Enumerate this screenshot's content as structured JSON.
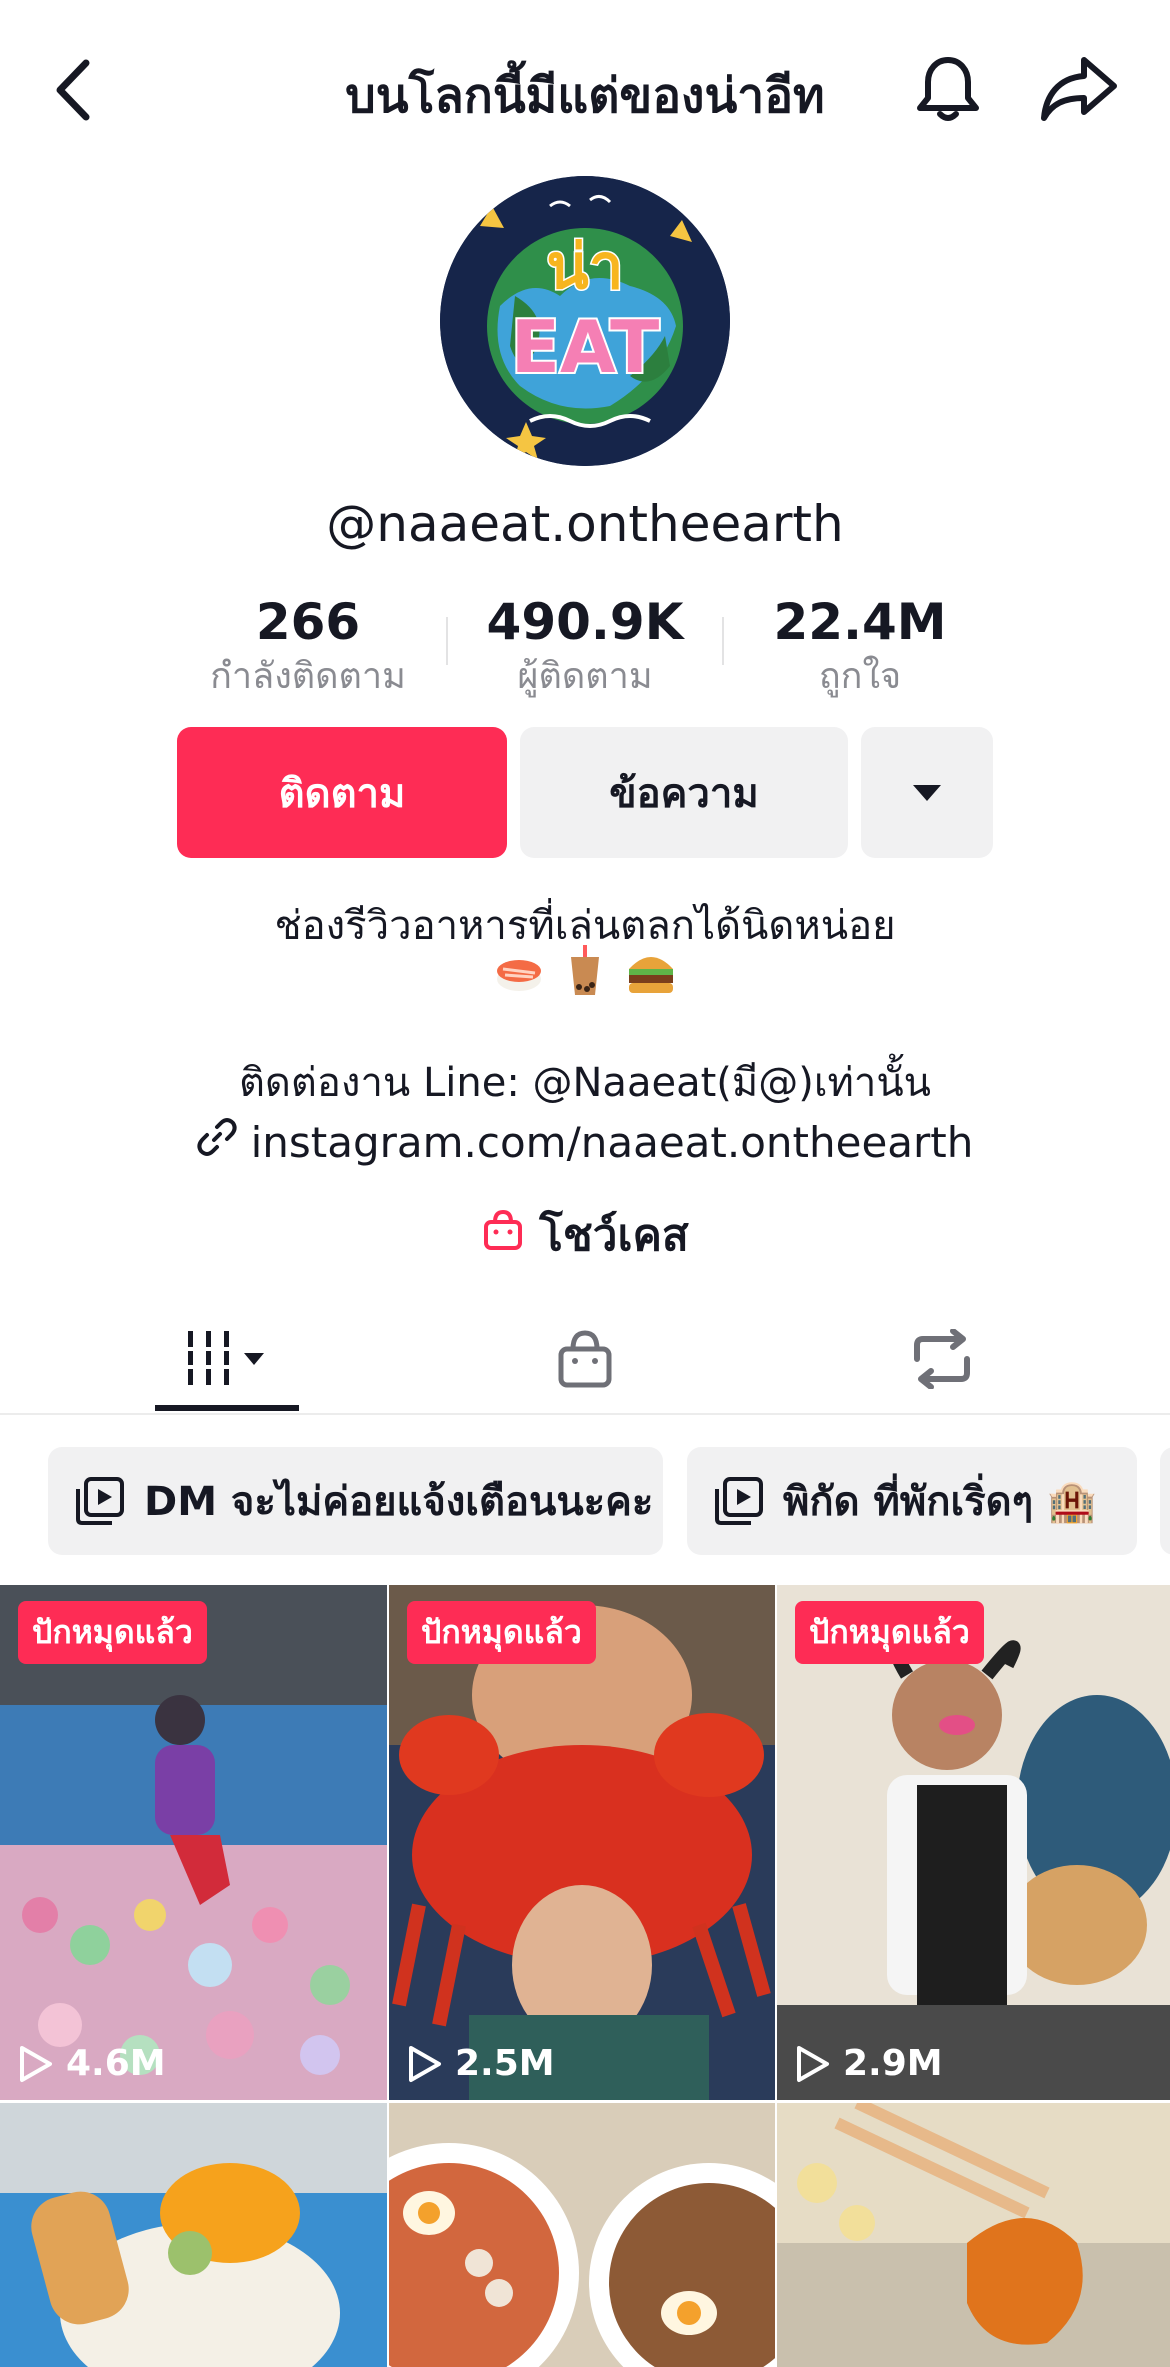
{
  "header": {
    "title": "บนโลกนี้มีแต่ของน่าอีท"
  },
  "profile": {
    "avatar_text_top": "น่า",
    "avatar_text_bottom": "EAT",
    "username": "@naaeat.ontheearth"
  },
  "stats": [
    {
      "value": "266",
      "label": "กำลังติดตาม"
    },
    {
      "value": "490.9K",
      "label": "ผู้ติดตาม"
    },
    {
      "value": "22.4M",
      "label": "ถูกใจ"
    }
  ],
  "buttons": {
    "follow": "ติดตาม",
    "message": "ข้อความ"
  },
  "bio": {
    "line1": "ช่องรีวิวอาหารที่เล่นตลกได้นิดหน่อย",
    "emojis": [
      "sushi-icon",
      "bubble-tea-icon",
      "burger-icon"
    ],
    "line2": "ติดต่องาน Line: @Naaeat(มี@)เท่านั้น",
    "link": "instagram.com/naaeat.ontheearth",
    "showcase": "โชว์เคส"
  },
  "tabs": [
    "videos-grid-icon",
    "shop-bag-icon",
    "repost-icon"
  ],
  "playlists": [
    {
      "label": "DM จะไม่ค่อยแจ้งเตือนนะคะ"
    },
    {
      "label": "พิกัด ที่พักเริ่ดๆ 🏨"
    }
  ],
  "videos": [
    {
      "pinned": "ปักหมุดแล้ว",
      "views": "4.6M"
    },
    {
      "pinned": "ปักหมุดแล้ว",
      "views": "2.5M"
    },
    {
      "pinned": "ปักหมุดแล้ว",
      "views": "2.9M"
    },
    {
      "pinned": "",
      "views": ""
    },
    {
      "pinned": "",
      "views": ""
    },
    {
      "pinned": "",
      "views": ""
    }
  ],
  "colors": {
    "accent": "#fe2c55",
    "text": "#161823",
    "secondary": "#8a8b91",
    "button_bg": "#f1f1f2"
  }
}
